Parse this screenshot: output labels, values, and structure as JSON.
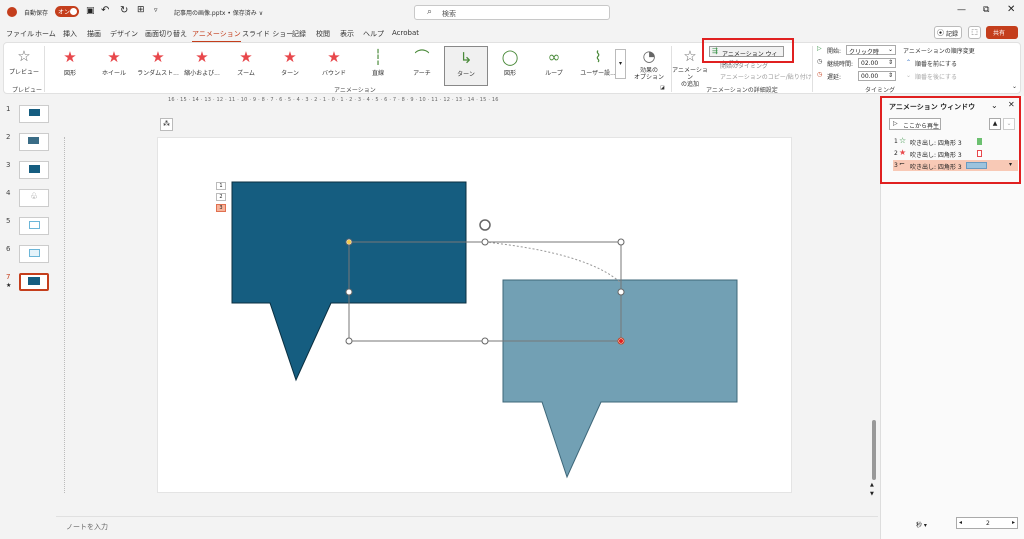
{
  "titlebar": {
    "autosave_label": "自動保存",
    "autosave_state": "オン",
    "file_title": "記事用の画像.pptx • 保存済み ∨",
    "search_placeholder": "検索",
    "record_label": "記録",
    "share_label": "共有"
  },
  "tabs": [
    "ファイル",
    "ホーム",
    "挿入",
    "描画",
    "デザイン",
    "画面切り替え",
    "アニメーション",
    "スライド ショー",
    "記録",
    "校閲",
    "表示",
    "ヘルプ",
    "Acrobat"
  ],
  "ribbon": {
    "preview": "プレビュー",
    "preview_group": "プレビュー",
    "animations": [
      {
        "label": "図形",
        "icon": "star-icon"
      },
      {
        "label": "ホイール",
        "icon": "star-icon"
      },
      {
        "label": "ランダムスト...",
        "icon": "star-icon"
      },
      {
        "label": "縮小および...",
        "icon": "star-icon"
      },
      {
        "label": "ズーム",
        "icon": "star-icon"
      },
      {
        "label": "ターン",
        "icon": "star-icon"
      },
      {
        "label": "バウンド",
        "icon": "star-icon"
      },
      {
        "label": "直線",
        "icon": "line-path-icon"
      },
      {
        "label": "アーチ",
        "icon": "arc-path-icon"
      },
      {
        "label": "ターン",
        "icon": "turn-path-icon"
      },
      {
        "label": "図形",
        "icon": "circle-path-icon"
      },
      {
        "label": "ループ",
        "icon": "loop-path-icon"
      },
      {
        "label": "ユーザー設...",
        "icon": "custom-path-icon"
      }
    ],
    "effect_options": "効果の\nオプション",
    "animation_group": "アニメーション",
    "add_animation": "アニメーション\nの追加",
    "animation_pane_btn": "アニメーション ウィンドウ",
    "trigger": "開始のタイミング",
    "painter": "アニメーションのコピー/貼り付け",
    "advanced_group": "アニメーションの詳細設定",
    "start_label": "開始:",
    "start_value": "クリック時",
    "duration_label": "継続時間:",
    "duration_value": "02.00",
    "delay_label": "遅延:",
    "delay_value": "00.00",
    "timing_group": "タイミング",
    "reorder_title": "アニメーションの順序変更",
    "move_earlier": "順番を前にする",
    "move_later": "順番を後にする"
  },
  "thumbnails": [
    "1",
    "2",
    "3",
    "4",
    "5",
    "6",
    "7"
  ],
  "slide": {
    "tags": [
      "1",
      "2",
      "3"
    ]
  },
  "pane": {
    "title": "アニメーション ウィンドウ",
    "play_from": "ここから再生",
    "items": [
      {
        "num": "1",
        "label": "吹き出し: 四角形 3"
      },
      {
        "num": "2",
        "label": "吹き出し: 四角形 3"
      },
      {
        "num": "3",
        "label": "吹き出し: 四角形 3"
      }
    ],
    "seconds_label": "秒 ▾",
    "page": "2"
  },
  "status": {
    "notes": "ノートを入力"
  },
  "ruler": {
    "top": "16 · 15 · 14 · 13 · 12 · 11 · 10 · 9 · 8 · 7 · 6 · 5 · 4 · 3 · 2 · 1 · 0 · 1 · 2 · 3 · 4 · 5 · 6 · 7 · 8 · 9 · 10 · 11 · 12 · 13 · 14 · 15 · 16"
  },
  "colors": {
    "accent": "#c43e1c",
    "dark_callout": "#155d80",
    "light_callout": "#72a0b4",
    "red_highlight": "#e02020"
  }
}
